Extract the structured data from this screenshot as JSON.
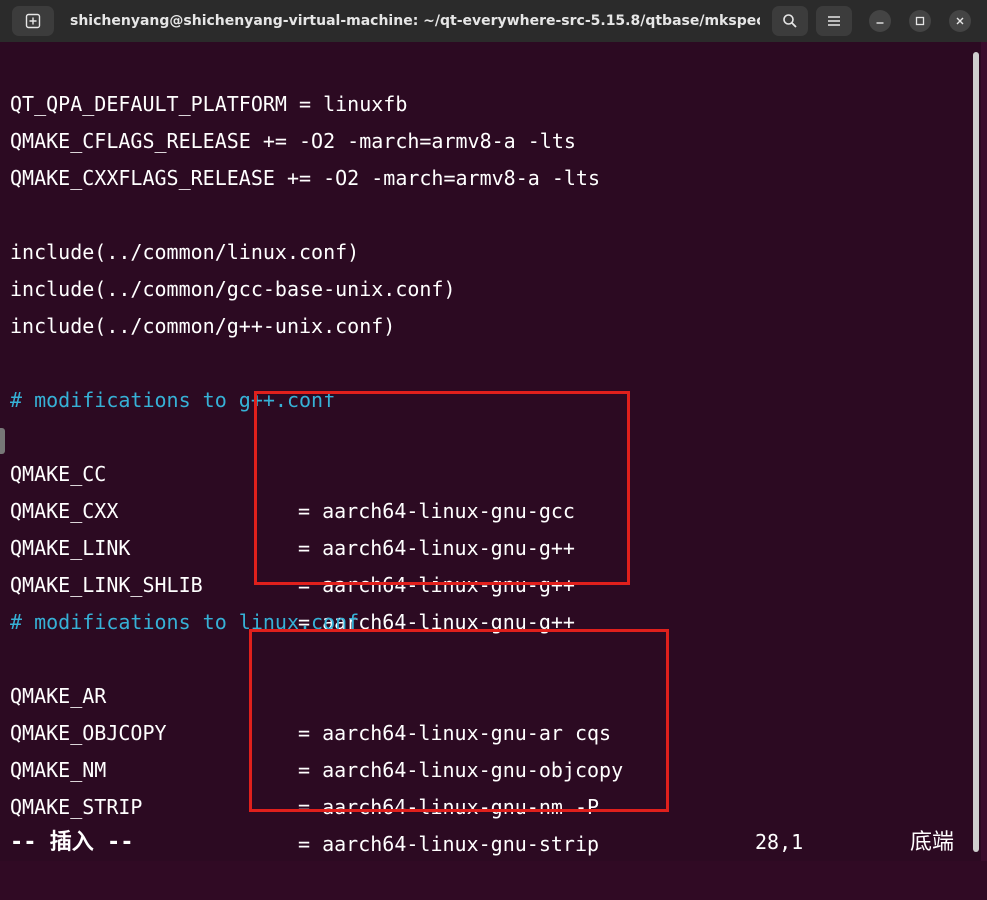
{
  "titlebar": {
    "title": "shichenyang@shichenyang-virtual-machine: ~/qt-everywhere-src-5.15.8/qtbase/mkspecs",
    "new_tab_icon": "new-tab-icon",
    "search_icon": "search-icon",
    "menu_icon": "hamburger-menu-icon",
    "minimize_icon": "minimize-icon",
    "maximize_icon": "maximize-icon",
    "close_icon": "close-icon"
  },
  "terminal": {
    "lines": [
      "QT_QPA_DEFAULT_PLATFORM = linuxfb",
      "QMAKE_CFLAGS_RELEASE += -O2 -march=armv8-a -lts",
      "QMAKE_CXXFLAGS_RELEASE += -O2 -march=armv8-a -lts",
      "include(../common/linux.conf)",
      "include(../common/gcc-base-unix.conf)",
      "include(../common/g++-unix.conf)"
    ],
    "comment1": "# modifications to g++.conf",
    "block1": [
      {
        "key": "QMAKE_CC",
        "value": "= aarch64-linux-gnu-gcc"
      },
      {
        "key": "QMAKE_CXX",
        "value": "= aarch64-linux-gnu-g++"
      },
      {
        "key": "QMAKE_LINK",
        "value": "= aarch64-linux-gnu-g++"
      },
      {
        "key": "QMAKE_LINK_SHLIB",
        "value": "= aarch64-linux-gnu-g++"
      }
    ],
    "comment2": "# modifications to linux.conf",
    "block2": [
      {
        "key": "QMAKE_AR",
        "value": "= aarch64-linux-gnu-ar cqs"
      },
      {
        "key": "QMAKE_OBJCOPY",
        "value": "= aarch64-linux-gnu-objcopy"
      },
      {
        "key": "QMAKE_NM",
        "value": "= aarch64-linux-gnu-nm -P"
      },
      {
        "key": "QMAKE_STRIP",
        "value": "= aarch64-linux-gnu-strip"
      }
    ]
  },
  "status": {
    "mode": "-- 插入 --",
    "position": "28,1",
    "scroll": "底端"
  },
  "colors": {
    "background": "#2c0a22",
    "comment": "#36b1d6",
    "highlight_box": "#e0201c"
  }
}
